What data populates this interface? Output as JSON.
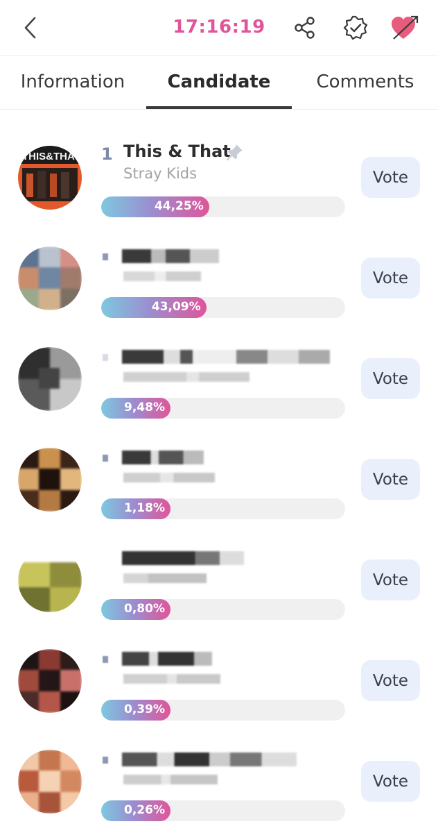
{
  "header": {
    "time": "17:16:19"
  },
  "tabs": [
    {
      "label": "Information"
    },
    {
      "label": "Candidate"
    },
    {
      "label": "Comments"
    }
  ],
  "candidates": [
    {
      "rank": "1",
      "title": "This & That",
      "artist": "Stray Kids",
      "percent_label": "44,25%",
      "percent": 44.25,
      "vote_label": "Vote"
    },
    {
      "rank": "",
      "title": "",
      "artist": "",
      "percent_label": "43,09%",
      "percent": 43.09,
      "vote_label": "Vote"
    },
    {
      "rank": "",
      "title": "",
      "artist": "",
      "percent_label": "9,48%",
      "percent": 9.48,
      "vote_label": "Vote"
    },
    {
      "rank": "",
      "title": "",
      "artist": "",
      "percent_label": "1,18%",
      "percent": 1.18,
      "vote_label": "Vote"
    },
    {
      "rank": "",
      "title": "",
      "artist": "",
      "percent_label": "0,80%",
      "percent": 0.8,
      "vote_label": "Vote"
    },
    {
      "rank": "",
      "title": "",
      "artist": "",
      "percent_label": "0,39%",
      "percent": 0.39,
      "vote_label": "Vote"
    },
    {
      "rank": "",
      "title": "",
      "artist": "",
      "percent_label": "0,26%",
      "percent": 0.26,
      "vote_label": "Vote"
    }
  ],
  "colors": {
    "accent_pink": "#e0559a",
    "bar_start": "#7ec8df",
    "bar_end": "#e0559a",
    "vote_bg": "#eaf0fb"
  },
  "icons": {
    "back": "chevron-left-icon",
    "share": "share-icon",
    "badge": "verified-badge-icon",
    "heart": "heart-arrow-icon",
    "pin": "pin-icon"
  }
}
